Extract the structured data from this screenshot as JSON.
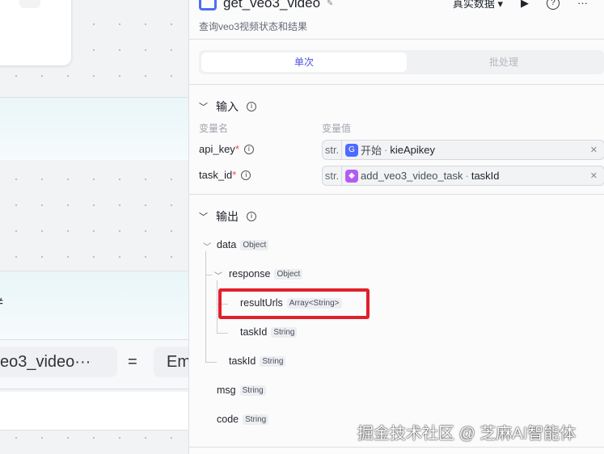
{
  "canvas": {
    "more_label": "···",
    "partial_symbol": "≠",
    "left_operand": "eo3_video···",
    "operator": "=",
    "right_operand": "Em"
  },
  "panel": {
    "title": "get_veo3_video",
    "description": "查询veo3视频状态和结果",
    "data_source": "真实数据 ▾",
    "tabs": [
      {
        "label": "单次",
        "active": true
      },
      {
        "label": "批处理",
        "active": false
      }
    ],
    "input": {
      "title": "输入",
      "col_name": "变量名",
      "col_value": "变量值",
      "params": [
        {
          "name": "api_key",
          "type": "str.",
          "node": "开始",
          "field": "kieApikey",
          "color": "#4d6bfe"
        },
        {
          "name": "task_id",
          "type": "str.",
          "node": "add_veo3_video_task",
          "field": "taskId",
          "color": "#b45cf0"
        }
      ]
    },
    "output": {
      "title": "输出",
      "tree": [
        {
          "name": "data",
          "type": "Object"
        },
        {
          "name": "response",
          "type": "Object"
        },
        {
          "name": "resultUrls",
          "type": "Array<String>"
        },
        {
          "name": "taskId",
          "type": "String"
        },
        {
          "name": "taskId",
          "type": "String"
        },
        {
          "name": "msg",
          "type": "String"
        },
        {
          "name": "code",
          "type": "String"
        }
      ]
    }
  },
  "watermark": "掘金技术社区 @ 芝麻AI智能体"
}
